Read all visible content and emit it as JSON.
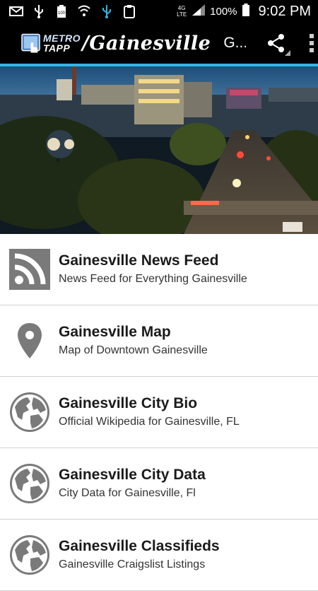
{
  "status_bar": {
    "battery_label": "100",
    "network": "4G LTE",
    "battery_percent": "100%",
    "time": "9:02 PM"
  },
  "action_bar": {
    "logo_metro": "METRO",
    "logo_tapp": "TAPP",
    "city": "/Gainesville",
    "short_title": "G...",
    "share_icon": "share-icon",
    "menu_icon": "overflow-menu-icon"
  },
  "colors": {
    "accent": "#33b5e5",
    "icon_gray": "#7a7a7a"
  },
  "list": [
    {
      "title": "Gainesville News Feed",
      "subtitle": "News Feed for Everything Gainesville",
      "icon": "rss-icon"
    },
    {
      "title": "Gainesville Map",
      "subtitle": "Map of Downtown Gainesville",
      "icon": "map-pin-icon"
    },
    {
      "title": "Gainesville City Bio",
      "subtitle": "Official Wikipedia for Gainesville, FL",
      "icon": "globe-icon"
    },
    {
      "title": "Gainesville City Data",
      "subtitle": "City Data for Gainesville, Fl",
      "icon": "globe-icon"
    },
    {
      "title": "Gainesville Classifieds",
      "subtitle": "Gainesville Craigslist Listings",
      "icon": "globe-icon"
    }
  ]
}
